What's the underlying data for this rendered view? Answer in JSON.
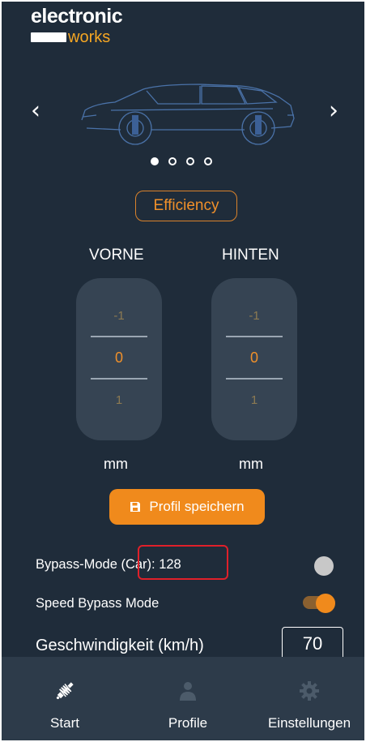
{
  "brand": {
    "line1": "electronic",
    "line2": "works"
  },
  "carousel": {
    "prev_icon": "chevron-left-icon",
    "next_icon": "chevron-right-icon",
    "pages": 4,
    "active_page": 1
  },
  "profile_badge": "Efficiency",
  "adjust": {
    "front": {
      "label": "VORNE",
      "above": "-1",
      "value": "0",
      "below": "1",
      "unit": "mm"
    },
    "rear": {
      "label": "HINTEN",
      "above": "-1",
      "value": "0",
      "below": "1",
      "unit": "mm"
    }
  },
  "save_button": {
    "label": "Profil speichern",
    "icon": "floppy-disk-icon"
  },
  "settings": {
    "bypass_mode": {
      "label": "Bypass-Mode (Car): 128",
      "enabled": false
    },
    "speed_bypass": {
      "label": "Speed Bypass Mode",
      "enabled": true
    },
    "speed": {
      "label": "Geschwindigkeit (km/h)",
      "value": "70"
    }
  },
  "tabs": [
    {
      "label": "Start",
      "icon": "shock-absorber-icon",
      "active": true
    },
    {
      "label": "Profile",
      "icon": "person-icon",
      "active": false
    },
    {
      "label": "Einstellungen",
      "icon": "gear-icon",
      "active": false
    }
  ],
  "colors": {
    "background": "#1f2c3a",
    "accent": "#f08a1c",
    "tabbar": "#2d3b4a",
    "highlight": "#e0202a"
  }
}
